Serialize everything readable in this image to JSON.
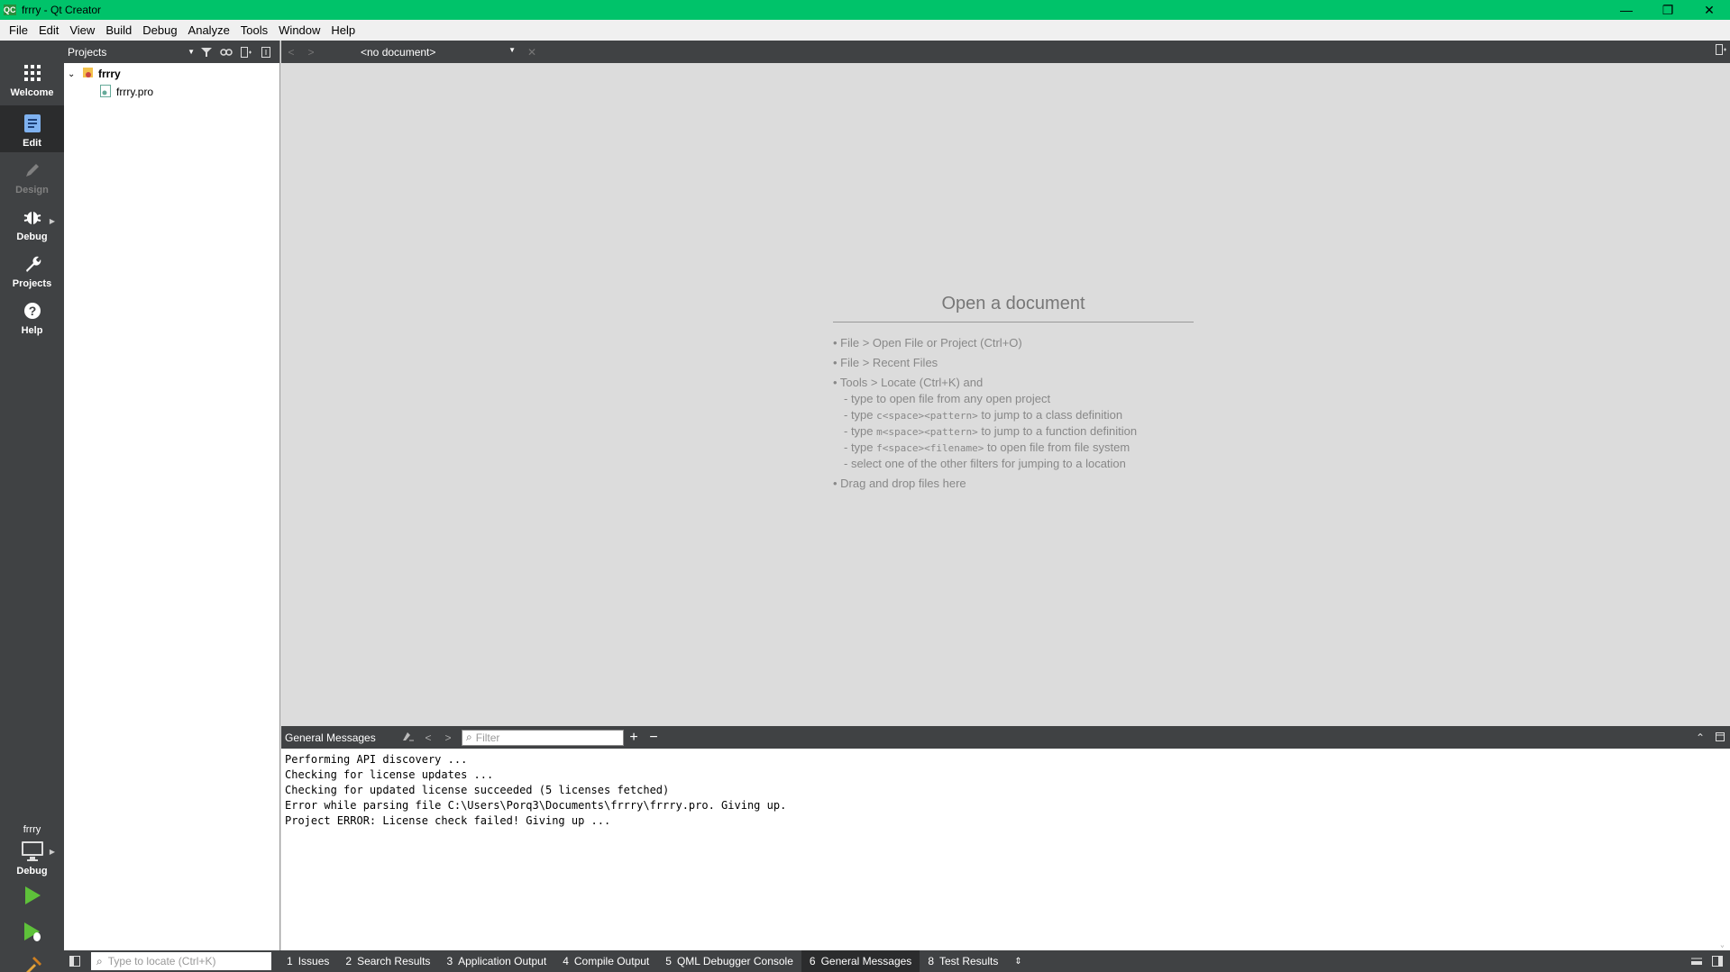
{
  "window": {
    "title": "frrry - Qt Creator",
    "logo_text": "QC",
    "min": "—",
    "max": "❐",
    "close": "✕"
  },
  "menu": [
    "File",
    "Edit",
    "View",
    "Build",
    "Debug",
    "Analyze",
    "Tools",
    "Window",
    "Help"
  ],
  "modes": [
    {
      "label": "Welcome",
      "icon": "grid-icon"
    },
    {
      "label": "Edit",
      "icon": "edit-document-icon"
    },
    {
      "label": "Design",
      "icon": "pencil-icon"
    },
    {
      "label": "Debug",
      "icon": "bug-icon"
    },
    {
      "label": "Projects",
      "icon": "wrench-icon"
    },
    {
      "label": "Help",
      "icon": "help-icon"
    }
  ],
  "sidebar": {
    "combo_label": "Projects",
    "tree": {
      "project": "frrry",
      "file": "frrry.pro"
    }
  },
  "editor_toolbar": {
    "document": "<no document>"
  },
  "welcome": {
    "title": "Open a document",
    "items": [
      "• File > Open File or Project (Ctrl+O)",
      "• File > Recent Files",
      "• Tools > Locate (Ctrl+K) and",
      "- type to open file from any open project",
      "- type ",
      "c<space><pattern>",
      " to jump to a class definition",
      "- type ",
      "m<space><pattern>",
      " to jump to a function definition",
      "- type ",
      "f<space><filename>",
      " to open file from file system",
      "- select one of the other filters for jumping to a location",
      "• Drag and drop files here"
    ]
  },
  "output": {
    "title": "General Messages",
    "filter_placeholder": "Filter",
    "plus": "+",
    "minus": "−",
    "lines": [
      "Performing API discovery ...",
      "Checking for license updates ...",
      "Checking for updated license succeeded (5 licenses fetched)",
      "Error while parsing file C:\\Users\\Porq3\\Documents\\frrry\\frrry.pro. Giving up.",
      "Project ERROR: License check failed! Giving up ..."
    ]
  },
  "kit": {
    "project": "frrry",
    "mode": "Debug"
  },
  "statusbar": {
    "locator_placeholder": "Type to locate (Ctrl+K)",
    "tabs": [
      {
        "num": "1",
        "label": "Issues"
      },
      {
        "num": "2",
        "label": "Search Results"
      },
      {
        "num": "3",
        "label": "Application Output"
      },
      {
        "num": "4",
        "label": "Compile Output"
      },
      {
        "num": "5",
        "label": "QML Debugger Console"
      },
      {
        "num": "6",
        "label": "General Messages"
      },
      {
        "num": "8",
        "label": "Test Results"
      }
    ]
  },
  "colors": {
    "titlebar": "#00c36a",
    "modebar": "#404244",
    "run_green": "#5ec13a"
  }
}
